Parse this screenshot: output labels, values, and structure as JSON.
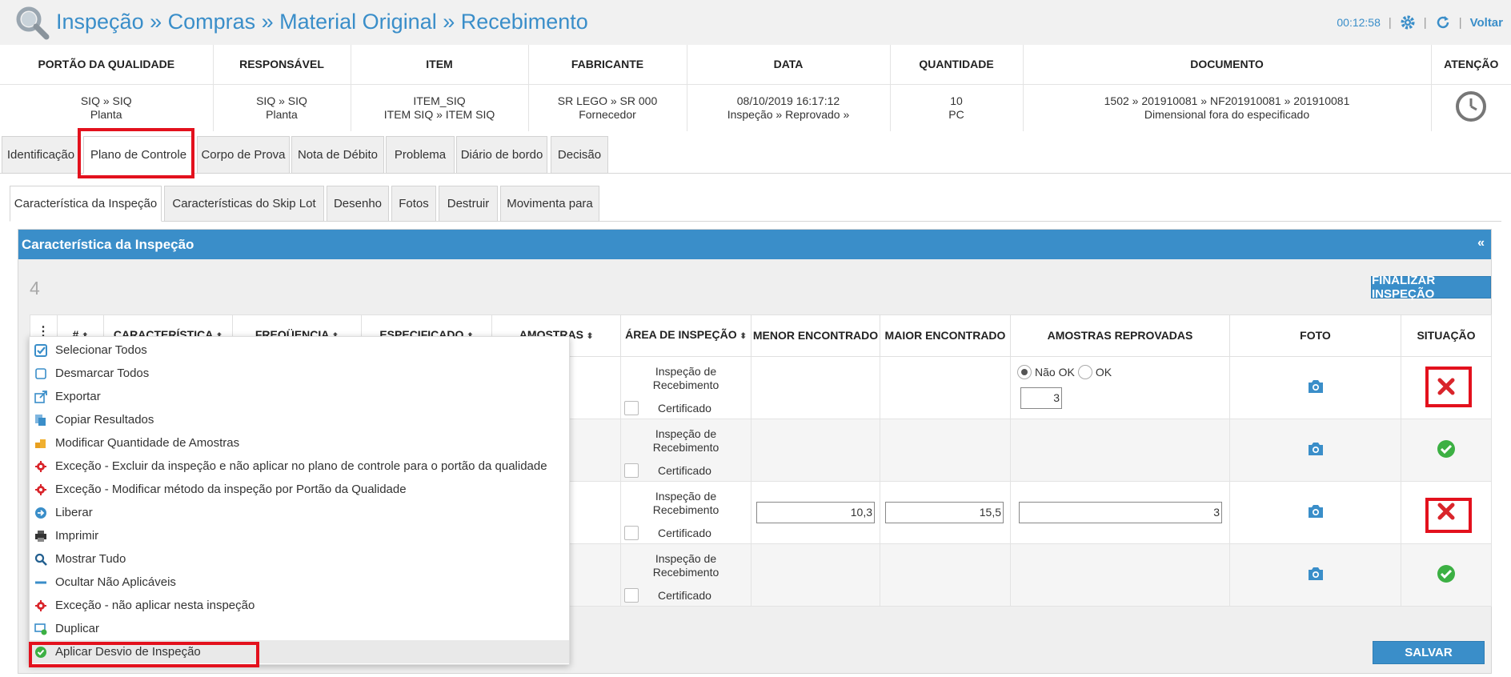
{
  "header": {
    "title": "Inspeção » Compras » Material Original » Recebimento",
    "timer": "00:12:58",
    "sep": "|",
    "back_label": "Voltar"
  },
  "info": {
    "columns": [
      "PORTÃO DA QUALIDADE",
      "RESPONSÁVEL",
      "ITEM",
      "FABRICANTE",
      "DATA",
      "QUANTIDADE",
      "DOCUMENTO",
      "ATENÇÃO"
    ],
    "values": [
      [
        "SIQ » SIQ",
        "Planta"
      ],
      [
        "SIQ » SIQ",
        "Planta"
      ],
      [
        "ITEM_SIQ",
        "ITEM SIQ » ITEM SIQ"
      ],
      [
        "SR LEGO » SR 000",
        "Fornecedor"
      ],
      [
        "08/10/2019 16:17:12",
        "Inspeção » Reprovado »"
      ],
      [
        "10",
        "PC"
      ],
      [
        "1502 » 201910081 » NF201910081 » 201910081",
        "Dimensional fora do especificado"
      ]
    ]
  },
  "tabs": [
    "Identificação",
    "Plano de Controle",
    "Corpo de Prova",
    "Nota de Débito",
    "Problema",
    "Diário de bordo",
    "Decisão"
  ],
  "subtabs": [
    "Característica da Inspeção",
    "Características do Skip Lot",
    "Desenho",
    "Fotos",
    "Destruir",
    "Movimenta para"
  ],
  "panel": {
    "title": "Característica da Inspeção",
    "collapse": "«",
    "count": "4",
    "finalize_label": "FINALIZAR INSPEÇÃO",
    "save_label": "SALVAR"
  },
  "grid": {
    "kebab": "⋮",
    "sort": "⬍",
    "headers": {
      "num": "#",
      "caracteristica": "CARACTERÍSTICA",
      "frequencia": "FREQÜENCIA",
      "especificado": "ESPECIFICADO",
      "amostras": "AMOSTRAS",
      "area": "ÁREA DE INSPEÇÃO",
      "menor": "MENOR ENCONTRADO",
      "maior": "MAIOR ENCONTRADO",
      "reprovadas": "AMOSTRAS REPROVADAS",
      "foto": "FOTO",
      "situacao": "SITUAÇÃO"
    },
    "rows": [
      {
        "area": "Inspeção de Recebimento",
        "cert": "Certificado",
        "status": "fail",
        "radio_nok": "Não OK",
        "radio_ok": "OK",
        "reprovadas": "3"
      },
      {
        "area": "Inspeção de Recebimento",
        "cert": "Certificado",
        "status": "ok"
      },
      {
        "area": "Inspeção de Recebimento",
        "cert": "Certificado",
        "status": "fail",
        "menor": "10,3",
        "maior": "15,5",
        "reprovadas": "3"
      },
      {
        "area": "Inspeção de Recebimento",
        "cert": "Certificado",
        "status": "ok"
      }
    ]
  },
  "menu": [
    {
      "label": "Selecionar Todos",
      "icon": "checkbox-checked-icon"
    },
    {
      "label": "Desmarcar Todos",
      "icon": "checkbox-empty-icon"
    },
    {
      "label": "Exportar",
      "icon": "export-icon"
    },
    {
      "label": "Copiar Resultados",
      "icon": "copy-icon"
    },
    {
      "label": "Modificar Quantidade de Amostras",
      "icon": "boxes-icon"
    },
    {
      "label": "Exceção - Excluir da inspeção e não aplicar no plano de controle para o portão da qualidade",
      "icon": "exception-icon"
    },
    {
      "label": "Exceção - Modificar método da inspeção por Portão da Qualidade",
      "icon": "exception-icon"
    },
    {
      "label": "Liberar",
      "icon": "arrow-right-icon"
    },
    {
      "label": "Imprimir",
      "icon": "printer-icon"
    },
    {
      "label": "Mostrar Tudo",
      "icon": "search-icon"
    },
    {
      "label": "Ocultar Não Aplicáveis",
      "icon": "minus-icon"
    },
    {
      "label": "Exceção - não aplicar nesta inspeção",
      "icon": "exception-icon"
    },
    {
      "label": "Duplicar",
      "icon": "duplicate-icon"
    },
    {
      "label": "Aplicar Desvio de Inspeção",
      "icon": "check-circle-icon"
    }
  ],
  "colors": {
    "accent": "#3a8ec9",
    "highlight": "#e3111d",
    "ok": "#3cb043",
    "fail": "#d9252b"
  }
}
